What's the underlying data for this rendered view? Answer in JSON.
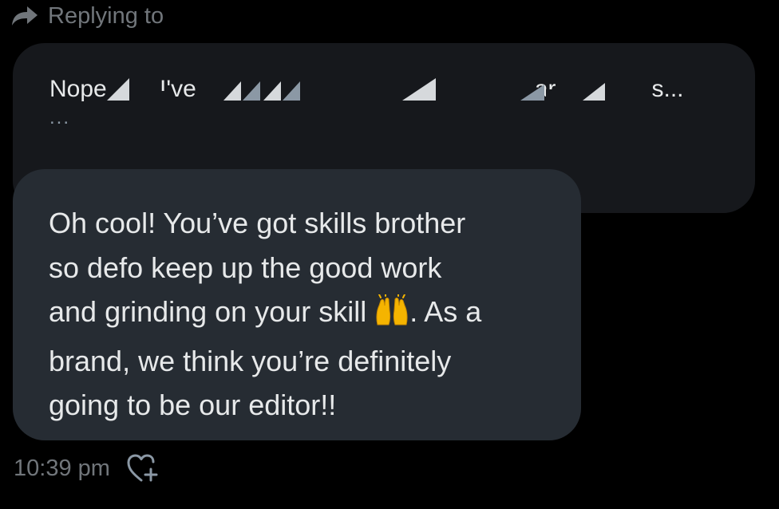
{
  "header": {
    "label": "Replying to"
  },
  "quoted_message": {
    "visible_prefix": "Nope",
    "visible_mid": " I've",
    "visible_tail_fragment": "ar",
    "visible_end": "s...",
    "ellipsis": "..."
  },
  "message": {
    "line1": "Oh cool! You’ve got skills brother",
    "line2": "so defo keep up the good work",
    "line3_before_emoji": "and grinding on your skill ",
    "line3_after_emoji": ". As a",
    "line4": "brand, we think you’re definitely",
    "line5": "going to be our editor!!",
    "emoji_name": "raising-hands-emoji"
  },
  "meta": {
    "timestamp": "10:39 pm",
    "react_icon": "heart-plus-icon"
  },
  "colors": {
    "background": "#000000",
    "quoted_bubble": "#16181c",
    "message_bubble": "#262c33",
    "text_primary": "#e7e9ea",
    "text_secondary": "#71767b"
  }
}
